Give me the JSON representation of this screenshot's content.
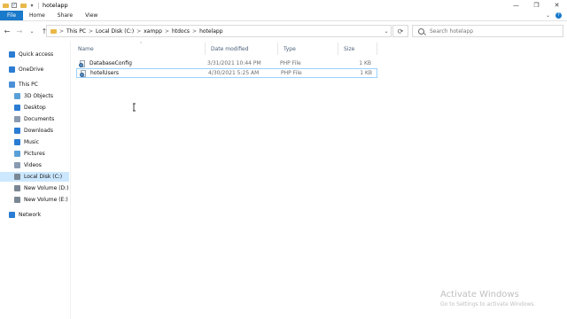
{
  "window": {
    "title": "hotelapp",
    "controls": [
      "—",
      "❐",
      "✕"
    ]
  },
  "ribbon": {
    "tabs": [
      "File",
      "Home",
      "Share",
      "View"
    ],
    "expand_icon": "chevron-down-icon",
    "help_icon": "help-icon"
  },
  "nav": {
    "back": "←",
    "forward": "→",
    "recent": "⌄",
    "up": "↑"
  },
  "address": {
    "crumbs": [
      "This PC",
      "Local Disk (C:)",
      "xampp",
      "htdocs",
      "hotelapp"
    ],
    "separator": ">",
    "dropdown": "⌄",
    "refresh": "⟳"
  },
  "search": {
    "placeholder": "Search hotelapp"
  },
  "sidebar": {
    "items": [
      {
        "label": "Quick access",
        "icon": "star-icon",
        "color": "#2b7cd3"
      },
      {
        "label": "OneDrive",
        "icon": "cloud-icon",
        "color": "#2b7cd3"
      },
      {
        "label": "This PC",
        "icon": "computer-icon",
        "color": "#4a90d9"
      },
      {
        "label": "3D Objects",
        "icon": "cube-icon",
        "color": "#5aa0d8"
      },
      {
        "label": "Desktop",
        "icon": "desktop-icon",
        "color": "#2b7cd3"
      },
      {
        "label": "Documents",
        "icon": "document-icon",
        "color": "#8a9bb0"
      },
      {
        "label": "Downloads",
        "icon": "download-icon",
        "color": "#2b7cd3"
      },
      {
        "label": "Music",
        "icon": "music-icon",
        "color": "#2b7cd3"
      },
      {
        "label": "Pictures",
        "icon": "pictures-icon",
        "color": "#5aa0d8"
      },
      {
        "label": "Videos",
        "icon": "videos-icon",
        "color": "#8a9bb0"
      },
      {
        "label": "Local Disk (C:)",
        "icon": "drive-icon",
        "color": "#7a8794",
        "selected": true
      },
      {
        "label": "New Volume (D:)",
        "icon": "drive-icon",
        "color": "#7a8794"
      },
      {
        "label": "New Volume (E:)",
        "icon": "drive-icon",
        "color": "#7a8794"
      },
      {
        "label": "Network",
        "icon": "network-icon",
        "color": "#2b7cd3"
      }
    ]
  },
  "columns": {
    "name": "Name",
    "date": "Date modified",
    "type": "Type",
    "size": "Size"
  },
  "files": [
    {
      "name": "DatabaseConfig",
      "date": "3/31/2021 10:44 PM",
      "type": "PHP File",
      "size": "1 KB",
      "icon": "php-file-icon"
    },
    {
      "name": "hotelUsers",
      "date": "4/30/2021 5:25 AM",
      "type": "PHP File",
      "size": "1 KB",
      "icon": "php-file-icon",
      "selected": true
    }
  ],
  "watermark": {
    "line1": "Activate Windows",
    "line2": "Go to Settings to activate Windows."
  }
}
